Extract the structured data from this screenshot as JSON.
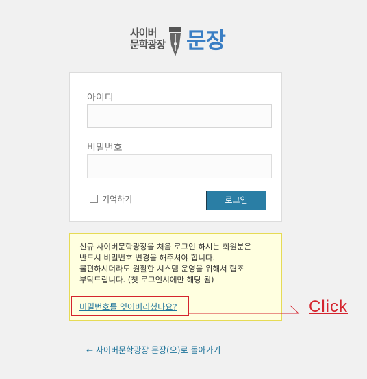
{
  "logo": {
    "line1": "사이버",
    "line2": "문학광장",
    "big": "문장"
  },
  "login_form": {
    "username_label": "아이디",
    "username_value": "",
    "password_label": "비밀번호",
    "password_value": "",
    "remember_label": "기억하기",
    "remember_checked": false,
    "submit_label": "로그인"
  },
  "notice": {
    "lines": [
      "신규 사이버문학광장을 처음 로그인 하시는 회원분은",
      "반드시 비밀번호 변경을 해주셔야 합니다.",
      "불편하시더라도 원활한 시스템 운영을 위해서 협조",
      "부탁드립니다. (첫 로그인시에만 해당 됨)"
    ],
    "lost_password_link": "비밀번호를 잊어버리셨나요?"
  },
  "annotation": {
    "label": "Click",
    "color": "#d4242e"
  },
  "back_link": "← 사이버문학광장 문장(으)로 돌아가기",
  "colors": {
    "accent": "#2a7ea5",
    "link": "#21759b",
    "logo_blue": "#3a7ec4",
    "notice_bg": "#ffffe0",
    "notice_border": "#e6db55"
  }
}
